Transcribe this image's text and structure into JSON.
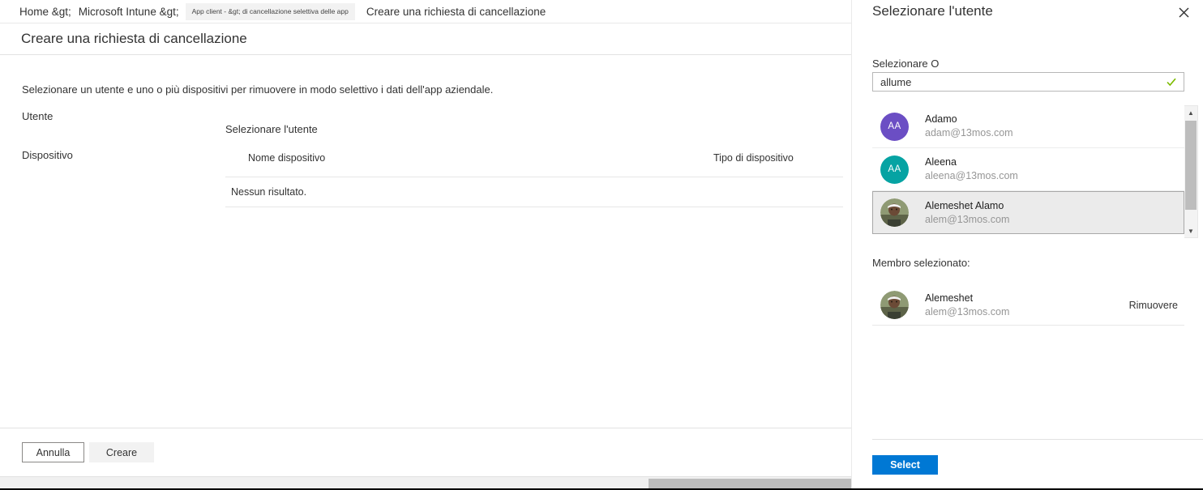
{
  "breadcrumb": {
    "items": [
      "Home &gt;",
      "Microsoft Intune &gt;",
      "App client - &gt; di cancellazione selettiva delle app",
      "Creare una richiesta di cancellazione"
    ]
  },
  "blade": {
    "title": "Creare una richiesta di cancellazione",
    "intro": "Selezionare un utente e uno o più dispositivi per rimuovere in modo selettivo i dati dell'app aziendale.",
    "user_label": "Utente",
    "user_picker_link": "Selezionare l'utente",
    "device_label": "Dispositivo",
    "device_table": {
      "columns": [
        "Nome dispositivo",
        "Tipo di dispositivo"
      ],
      "empty_text": "Nessun risultato.",
      "rows": []
    },
    "footer": {
      "cancel_label": "Annulla",
      "create_label": "Creare"
    }
  },
  "panel": {
    "title": "Selezionare l'utente",
    "close_icon": "close-icon",
    "field_label": "Selezionare O",
    "search": {
      "value": "allume",
      "placeholder": "",
      "valid_icon": "checkmark-icon",
      "valid_color": "#7cbb00"
    },
    "users": [
      {
        "name": "Adamo",
        "email": "adam@13mos.com",
        "initials": "AA",
        "avatar_type": "initials",
        "avatar_color": "#6b4ec4",
        "selected": false
      },
      {
        "name": "Aleena",
        "email": "aleena@13mos.com",
        "initials": "AA",
        "avatar_type": "initials",
        "avatar_color": "#06a3a3",
        "selected": false
      },
      {
        "name": "Alemeshet Alamo",
        "email": "alem@13mos.com",
        "initials": "",
        "avatar_type": "photo",
        "avatar_color": "#8a8f72",
        "selected": true
      }
    ],
    "selected_member_label": "Membro selezionato:",
    "selected_member": {
      "name": "Alemeshet",
      "email": "alem@13mos.com",
      "avatar_type": "photo",
      "remove_label": "Rimuovere"
    },
    "footer": {
      "select_label": "Select",
      "select_color": "#0078d4"
    }
  }
}
